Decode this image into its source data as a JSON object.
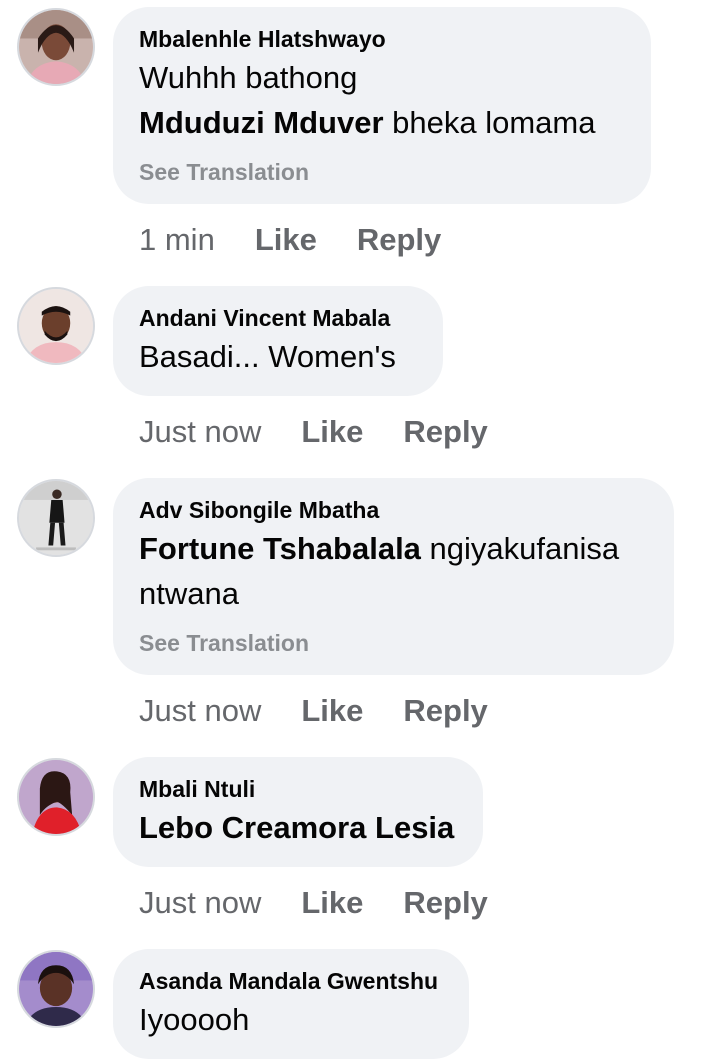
{
  "comments": [
    {
      "author": "Mbalenhle Hlatshwayo",
      "mention": "Mduduzi Mduver",
      "line1": "Wuhhh bathong",
      "text_after_mention": " bheka lomama",
      "see_translation": "See Translation",
      "time": "1 min",
      "like": "Like",
      "reply": "Reply"
    },
    {
      "author": "Andani Vincent Mabala",
      "text": "Basadi... Women's",
      "time": "Just now",
      "like": "Like",
      "reply": "Reply"
    },
    {
      "author": "Adv Sibongile Mbatha",
      "mention": "Fortune Tshabalala",
      "text_after_mention": " ngiyakufanisa",
      "line2": "ntwana",
      "see_translation": "See Translation",
      "time": "Just now",
      "like": "Like",
      "reply": "Reply"
    },
    {
      "author": "Mbali Ntuli",
      "mention": "Lebo Creamora Lesia",
      "time": "Just now",
      "like": "Like",
      "reply": "Reply"
    },
    {
      "author": "Asanda Mandala Gwentshu",
      "text": "Iyooooh"
    }
  ],
  "avatars": [
    {
      "icon": "profile-photo-woman-icon",
      "bg": "#c9a79a"
    },
    {
      "icon": "profile-photo-man-icon",
      "bg": "#e7d7d2"
    },
    {
      "icon": "profile-photo-standing-woman-icon",
      "bg": "#d8d8d8"
    },
    {
      "icon": "profile-photo-woman-red-icon",
      "bg": "#b9a6c9"
    },
    {
      "icon": "profile-photo-woman-purple-icon",
      "bg": "#a98fcf"
    }
  ],
  "colors": {
    "bubble": "#f0f2f5",
    "text": "#050505",
    "meta": "#65676b",
    "see_translation": "#8a8d91"
  }
}
